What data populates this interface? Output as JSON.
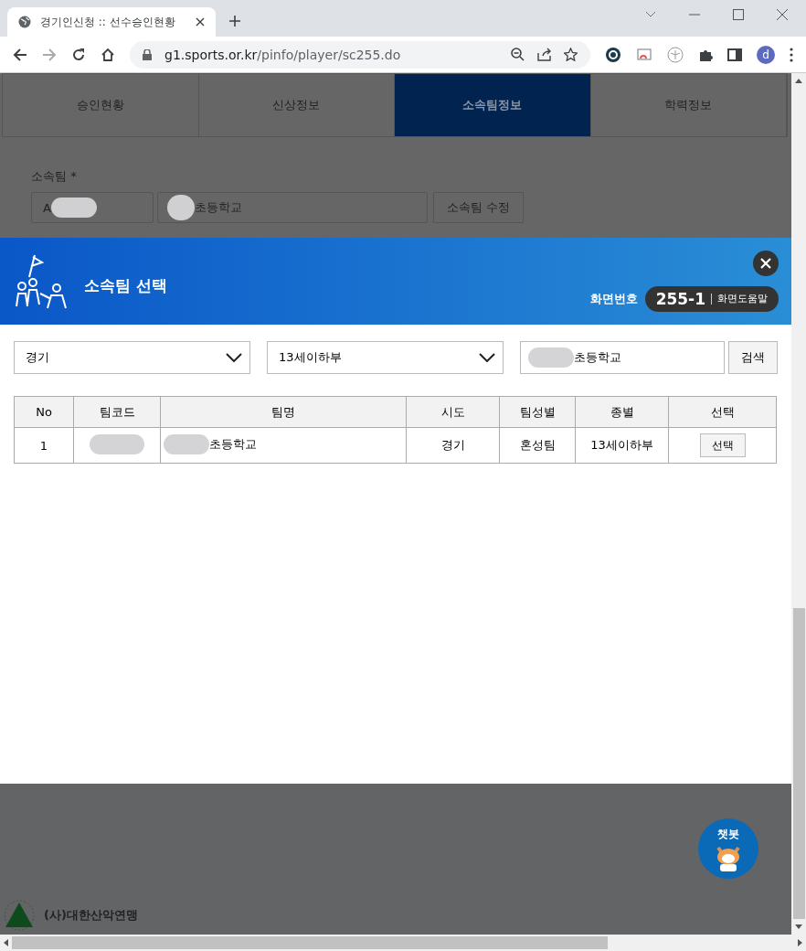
{
  "browser": {
    "tab_title": "경기인신청 :: 선수승인현황",
    "url_host": "g1.sports.or.kr",
    "url_path": "/pinfo/player/sc255.do",
    "profile": "d"
  },
  "page_tabs": [
    {
      "label": "승인현황",
      "selected": false
    },
    {
      "label": "신상정보",
      "selected": false
    },
    {
      "label": "소속팀정보",
      "selected": true
    },
    {
      "label": "학력정보",
      "selected": false
    }
  ],
  "team_field": {
    "label": "소속팀 *",
    "code_value": "A",
    "name_value": "초등학교",
    "edit_button": "소속팀 수정"
  },
  "modal": {
    "title": "소속팀 선택",
    "screen_label": "화면번호",
    "screen_no": "255-1",
    "help": "화면도움말",
    "region": "경기",
    "division": "13세이하부",
    "search_value": "초등학교",
    "search_button": "검색",
    "columns": [
      "No",
      "팀코드",
      "팀명",
      "시도",
      "팀성별",
      "종별",
      "선택"
    ],
    "rows": [
      {
        "no": "1",
        "team_name": "초등학교",
        "region": "경기",
        "gender": "혼성팀",
        "division": "13세이하부",
        "action": "선택"
      }
    ]
  },
  "chatbot": "챗봇",
  "org": "(사)대한산악연맹"
}
